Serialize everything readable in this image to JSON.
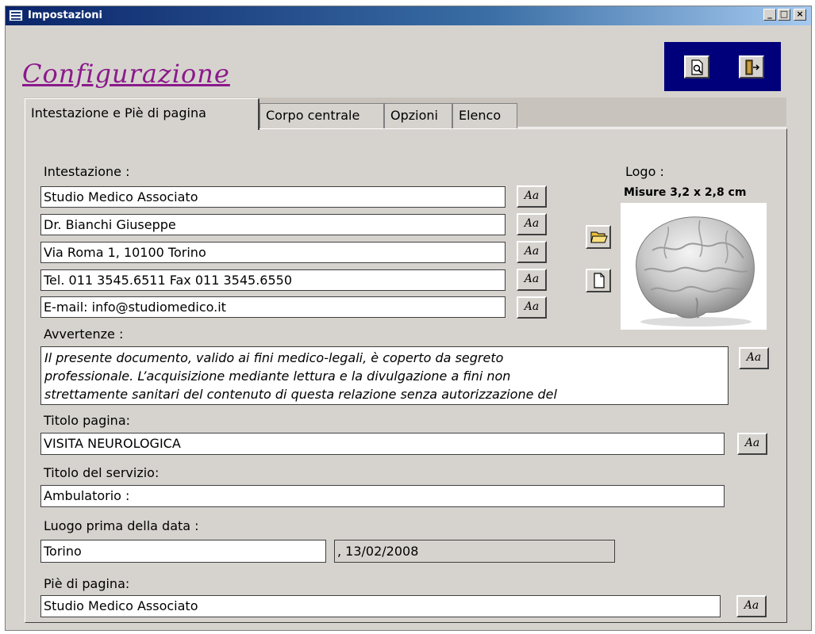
{
  "window": {
    "title": "Impostazioni",
    "min": "_",
    "max": "□",
    "close": "×"
  },
  "caption": "Configurazione",
  "toolbar": {
    "preview_icon": "print-preview-icon",
    "exit_icon": "exit-door-icon"
  },
  "tabs": [
    "Intestazione e Piè di pagina",
    "Corpo centrale",
    "Opzioni",
    "Elenco"
  ],
  "active_tab": "Intestazione e Piè di pagina",
  "intestazione": {
    "label": "Intestazione :",
    "lines": [
      "Studio Medico Associato",
      "Dr. Bianchi Giuseppe",
      "Via Roma 1, 10100 Torino",
      "Tel. 011 3545.6511 Fax 011 3545.6550",
      "E-mail: info@studiomedico.it"
    ]
  },
  "font_button": "Aa",
  "logo": {
    "label": "Logo :",
    "size_text": "Misure 3,2 x 2,8 cm",
    "open_icon": "open-folder-icon",
    "new_icon": "blank-page-icon",
    "image_icon": "brain-image"
  },
  "avvertenze": {
    "label": "Avvertenze :",
    "lines": [
      "Il presente documento, valido ai fini medico-legali, è coperto da segreto",
      "professionale. L’acquisizione mediante lettura e la divulgazione a fini non",
      "strettamente sanitari del contenuto di questa relazione senza autorizzazione del"
    ]
  },
  "titolo_pagina": {
    "label": "Titolo pagina:",
    "value": "VISITA NEUROLOGICA"
  },
  "titolo_servizio": {
    "label": "Titolo del servizio:",
    "value": "Ambulatorio :"
  },
  "luogo": {
    "label": "Luogo prima della data :",
    "value": "Torino",
    "date_preview": ", 13/02/2008"
  },
  "pie_pagina": {
    "label": "Piè di pagina:",
    "value": "Studio Medico Associato"
  },
  "colors": {
    "titlebar": "#0a246a",
    "caption": "#8b1a8b",
    "toolbar_bg": "#00007a",
    "face": "#d6d3ce"
  }
}
